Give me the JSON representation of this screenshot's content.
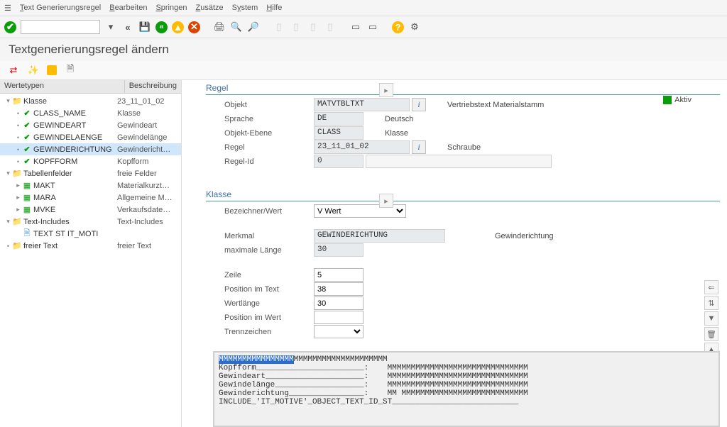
{
  "menu": {
    "items": [
      "Text Generierungsregel",
      "Bearbeiten",
      "Springen",
      "Zusätze",
      "System",
      "Hilfe"
    ],
    "underlines": [
      "T",
      "B",
      "S",
      "Z",
      "y",
      "H"
    ]
  },
  "title": "Textgenerierungsregel ändern",
  "tree_header": {
    "col1": "Wertetypen",
    "col2": "Beschreibung"
  },
  "tree": [
    {
      "lvl": 0,
      "tog": "v",
      "ic": "folder-search",
      "lbl": "Klasse",
      "desc": "23_11_01_02"
    },
    {
      "lvl": 1,
      "tog": "•",
      "ic": "check",
      "lbl": "CLASS_NAME",
      "desc": "Klasse"
    },
    {
      "lvl": 1,
      "tog": "•",
      "ic": "check",
      "lbl": "GEWINDEART",
      "desc": "Gewindeart"
    },
    {
      "lvl": 1,
      "tog": "•",
      "ic": "check",
      "lbl": "GEWINDELAENGE",
      "desc": "Gewindelänge"
    },
    {
      "lvl": 1,
      "tog": "•",
      "ic": "check",
      "lbl": "GEWINDERICHTUNG",
      "desc": "Gewindericht…",
      "sel": true
    },
    {
      "lvl": 1,
      "tog": "•",
      "ic": "check",
      "lbl": "KOPFFORM",
      "desc": "Kopfform"
    },
    {
      "lvl": 0,
      "tog": "v",
      "ic": "folder-table",
      "lbl": "Tabellenfelder",
      "desc": "freie Felder"
    },
    {
      "lvl": 1,
      "tog": ">",
      "ic": "table",
      "lbl": "MAKT",
      "desc": "Materialkurzt…"
    },
    {
      "lvl": 1,
      "tog": ">",
      "ic": "table",
      "lbl": "MARA",
      "desc": "Allgemeine M…"
    },
    {
      "lvl": 1,
      "tog": ">",
      "ic": "table",
      "lbl": "MVKE",
      "desc": "Verkaufsdate…"
    },
    {
      "lvl": 0,
      "tog": "v",
      "ic": "folder-doc",
      "lbl": "Text-Includes",
      "desc": "Text-Includes"
    },
    {
      "lvl": 1,
      "tog": "",
      "ic": "doc",
      "lbl": "TEXT ST IT_MOTI",
      "desc": ""
    },
    {
      "lvl": 0,
      "tog": "•",
      "ic": "folder-doc",
      "lbl": "freier Text",
      "desc": "freier Text"
    }
  ],
  "regel": {
    "head": "Regel",
    "rows": [
      {
        "label": "Objekt",
        "val": "MATVTBLTXT",
        "help": true,
        "rtext": "Vertriebstext Materialstamm"
      },
      {
        "label": "Sprache",
        "val": "DE",
        "help": false,
        "rtext": "Deutsch",
        "w": "w60"
      },
      {
        "label": "Objekt-Ebene",
        "val": "CLASS",
        "help": false,
        "rtext": "Klasse",
        "w": "w60"
      },
      {
        "label": "Regel",
        "val": "23_11_01_02",
        "help": true,
        "rtext": "Schraube"
      },
      {
        "label": "Regel-Id",
        "val": "0",
        "help": false,
        "rtext": "",
        "w": "w60",
        "wide_extra": true
      }
    ],
    "aktiv": "Aktiv"
  },
  "klasse": {
    "head": "Klasse",
    "bez_label": "Bezeichner/Wert",
    "bez_val": "V Wert",
    "merkmal_label": "Merkmal",
    "merkmal_val": "GEWINDERICHTUNG",
    "merkmal_rtext": "Gewinderichtung",
    "maxlen_label": "maximale Länge",
    "maxlen_val": "30",
    "zeile_label": "Zeile",
    "zeile_val": "5",
    "pos_label": "Position im Text",
    "pos_val": "38",
    "wlen_label": "Wertlänge",
    "wlen_val": "30",
    "pwert_label": "Position im Wert",
    "pwert_val": "",
    "trenn_label": "Trennzeichen",
    "trenn_val": ""
  },
  "preview": {
    "l1a": "MMMMMMMMMMMMMMMM",
    "l1b": "MMMMMMMMMMMMMMMMMMMM",
    "l2": "Kopfform_______________________:    MMMMMMMMMMMMMMMMMMMMMMMMMMMMMM",
    "l3": "Gewindeart_____________________:    MMMMMMMMMMMMMMMMMMMMMMMMMMMMMM",
    "l4": "Gewindelänge___________________:    MMMMMMMMMMMMMMMMMMMMMMMMMMMMMM",
    "l5": "Gewinderichtung________________:    MM MMMMMMMMMMMMMMMMMMMMMMMMMMM",
    "l6": "INCLUDE_'IT_MOTIVE'_OBJECT_TEXT_ID_ST___________________________"
  }
}
